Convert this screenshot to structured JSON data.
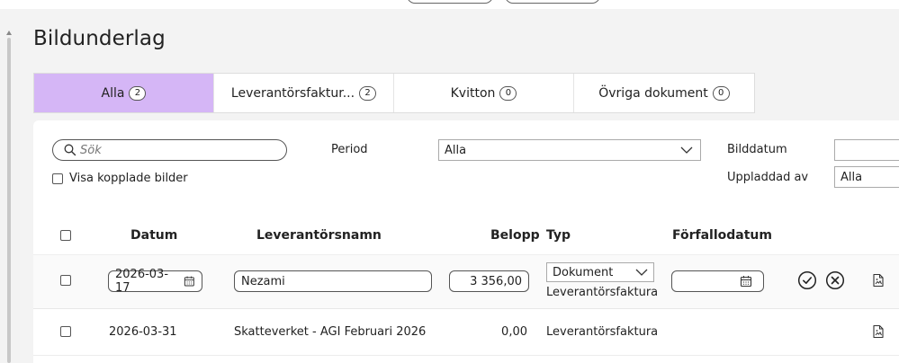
{
  "page": {
    "title": "Bildunderlag"
  },
  "tabs": [
    {
      "label": "Alla",
      "count": "2",
      "active": true
    },
    {
      "label": "Leverantörsfaktur...",
      "count": "2",
      "active": false
    },
    {
      "label": "Kvitton",
      "count": "0",
      "active": false
    },
    {
      "label": "Övriga dokument",
      "count": "0",
      "active": false
    }
  ],
  "filters": {
    "search_placeholder": "Sök",
    "visa_kopplade_label": "Visa kopplade bilder",
    "period_label": "Period",
    "period_value": "Alla",
    "bilddatum_label": "Bilddatum",
    "uppladdad_label": "Uppladdad av",
    "uppladdad_value": "Alla"
  },
  "table": {
    "headers": {
      "datum": "Datum",
      "leverantor": "Leverantörsnamn",
      "belopp": "Belopp",
      "typ": "Typ",
      "forfallo": "Förfallodatum"
    },
    "rows": [
      {
        "datum": "2026-03-17",
        "leverantor": "Nezami",
        "belopp": "3 356,00",
        "typ_select": "Dokument",
        "typ": "Leverantörsfaktura",
        "forfallo": ""
      },
      {
        "datum": "2026-03-31",
        "leverantor": "Skatteverket - AGI Februari 2026",
        "belopp": "0,00",
        "typ": "Leverantörsfaktura"
      }
    ]
  },
  "colors": {
    "active_tab": "#d5b6f6",
    "panel_bg": "#ffffff",
    "page_bg": "#f3f3f3"
  }
}
